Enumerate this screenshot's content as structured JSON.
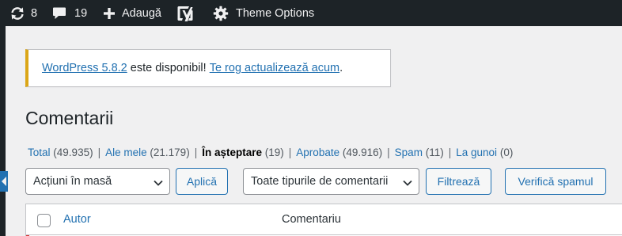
{
  "adminbar": {
    "updates_count": "8",
    "comments_count": "19",
    "new_label": "Adaugă",
    "theme_options_label": "Theme Options",
    "icons": [
      "updates-icon",
      "comment-bubble-icon",
      "plus-icon",
      "yoast-icon",
      "gear-icon"
    ]
  },
  "notice": {
    "version_link": "WordPress 5.8.2",
    "middle_text": " este disponibil! ",
    "update_link": "Te rog actualizează acum",
    "end_text": ".",
    "accent_color": "#dba617"
  },
  "page_title": "Comentarii",
  "filters": [
    {
      "label": "Total",
      "count": "(49.935)",
      "current": false
    },
    {
      "label": "Ale mele",
      "count": "(21.179)",
      "current": false
    },
    {
      "label": "În așteptare",
      "count": "(19)",
      "current": true
    },
    {
      "label": "Aprobate",
      "count": "(49.916)",
      "current": false
    },
    {
      "label": "Spam",
      "count": "(11)",
      "current": false
    },
    {
      "label": "La gunoi",
      "count": "(0)",
      "current": false
    }
  ],
  "filter_separator": "|",
  "tablenav": {
    "bulk_actions_value": "Acțiuni în masă",
    "apply_label": "Aplică",
    "comment_type_value": "Toate tipurile de comentarii",
    "filter_label": "Filtrează",
    "check_spam_label": "Verifică spamul"
  },
  "table": {
    "columns": [
      "Autor",
      "Comentariu"
    ]
  },
  "colors": {
    "link": "#2271b1",
    "adminbar_bg": "#1d2327",
    "page_bg": "#f0f0f1"
  }
}
